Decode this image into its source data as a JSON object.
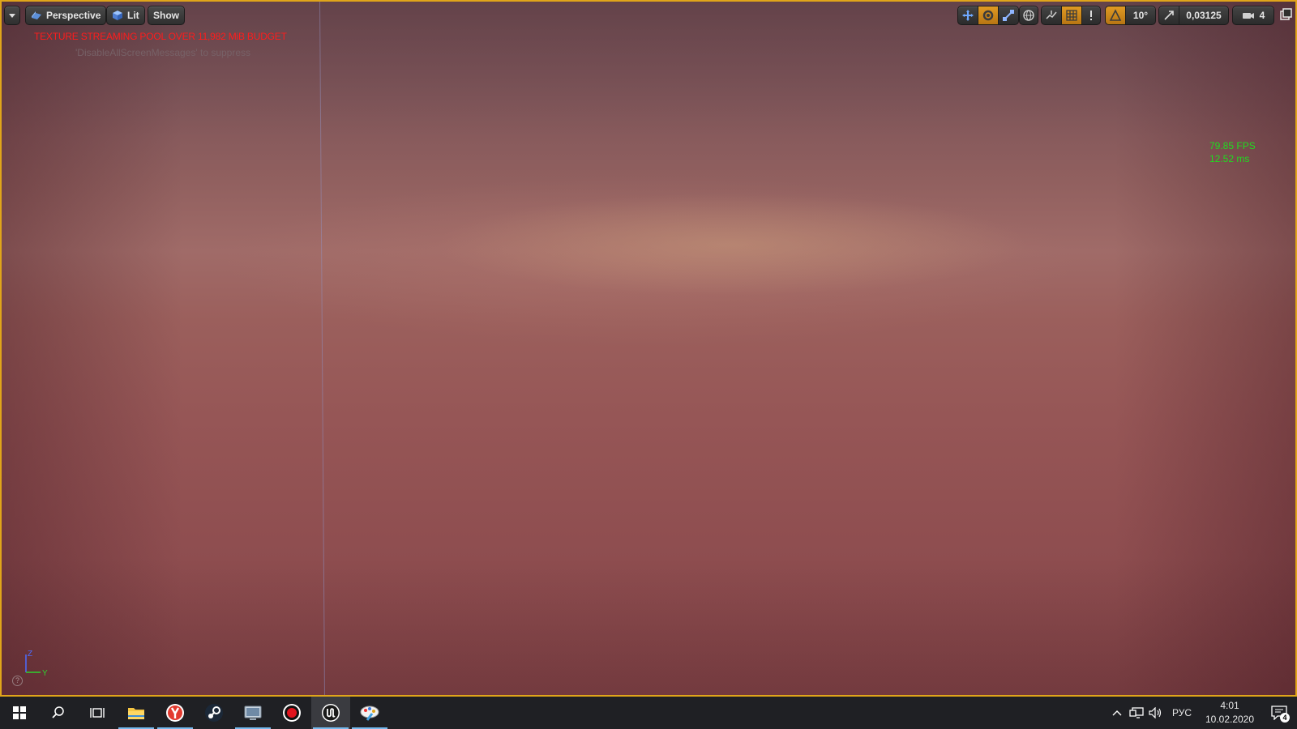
{
  "viewport": {
    "toolbar_left": {
      "options_menu": "viewport-options",
      "perspective_label": "Perspective",
      "lit_label": "Lit",
      "show_label": "Show"
    },
    "messages": {
      "warning": "TEXTURE STREAMING POOL OVER 11,982 MiB BUDGET",
      "hint": "'DisableAllScreenMessages' to suppress"
    },
    "toolbar_right": {
      "rotation_snap": "10°",
      "scale_snap": "0,03125",
      "camera_speed": "4"
    },
    "stats": {
      "fps": "79.85 FPS",
      "ms": "12.52 ms"
    },
    "axis": {
      "z": "Z",
      "y": "Y"
    },
    "help": "?",
    "colors": {
      "border": "#e0a51a",
      "warning": "#ff1c1c",
      "fps": "#1fdc1f",
      "active_button": "#e09a23"
    }
  },
  "taskbar": {
    "apps": [
      "start-icon",
      "search-icon",
      "task-view-icon",
      "file-explorer-icon",
      "yandex-browser-icon",
      "steam-icon",
      "app-icon",
      "record-icon",
      "unreal-engine-icon",
      "paint-icon"
    ],
    "language": "РУС",
    "time": "4:01",
    "date": "10.02.2020",
    "notifications": "4"
  }
}
